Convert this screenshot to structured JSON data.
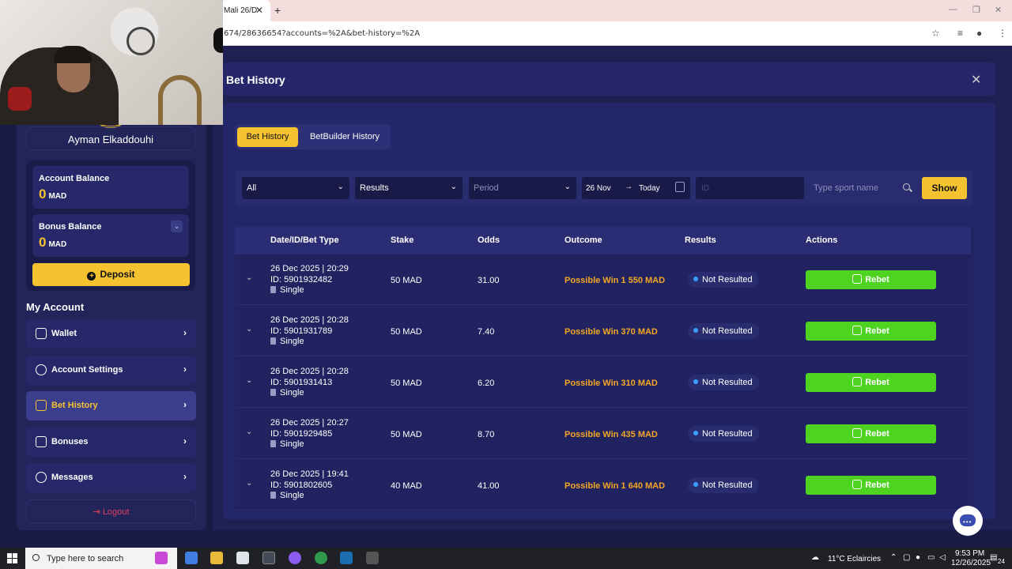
{
  "browser": {
    "tab_title": "Mali 26/D",
    "tab_close": "✕",
    "new_tab": "+",
    "url": "674/28636654?accounts=%2A&bet-history=%2A"
  },
  "sidebar": {
    "username": "Ayman Elkaddouhi",
    "account_balance": {
      "label": "Account Balance",
      "value": "0",
      "unit": "MAD"
    },
    "bonus_balance": {
      "label": "Bonus Balance",
      "value": "0",
      "unit": "MAD"
    },
    "deposit_label": "Deposit",
    "section_title": "My Account",
    "items": [
      {
        "label": "Wallet",
        "active": false
      },
      {
        "label": "Account Settings",
        "active": false
      },
      {
        "label": "Bet History",
        "active": true
      },
      {
        "label": "Bonuses",
        "active": false
      },
      {
        "label": "Messages",
        "active": false
      }
    ],
    "logout_label": "Logout"
  },
  "main": {
    "title": "Bet History",
    "tabs": [
      {
        "label": "Bet History",
        "active": true
      },
      {
        "label": "BetBuilder History",
        "active": false
      }
    ],
    "filters": {
      "type_select": "All",
      "results_select": "Results",
      "period_select": "Period",
      "date_from": "26 Nov",
      "date_to": "Today",
      "id_placeholder": "ID",
      "sport_placeholder": "Type sport name",
      "show_label": "Show"
    },
    "table": {
      "headers": [
        "Date/ID/Bet Type",
        "Stake",
        "Odds",
        "Outcome",
        "Results",
        "Actions"
      ],
      "rows": [
        {
          "date": "26 Dec 2025 | 20:29",
          "id": "ID: 5901932482",
          "type": "Single",
          "stake": "50 MAD",
          "odds": "31.00",
          "outcome": "Possible Win 1 550 MAD",
          "result": "Not Resulted",
          "action": "Rebet"
        },
        {
          "date": "26 Dec 2025 | 20:28",
          "id": "ID: 5901931789",
          "type": "Single",
          "stake": "50 MAD",
          "odds": "7.40",
          "outcome": "Possible Win 370 MAD",
          "result": "Not Resulted",
          "action": "Rebet"
        },
        {
          "date": "26 Dec 2025 | 20:28",
          "id": "ID: 5901931413",
          "type": "Single",
          "stake": "50 MAD",
          "odds": "6.20",
          "outcome": "Possible Win 310 MAD",
          "result": "Not Resulted",
          "action": "Rebet"
        },
        {
          "date": "26 Dec 2025 | 20:27",
          "id": "ID: 5901929485",
          "type": "Single",
          "stake": "50 MAD",
          "odds": "8.70",
          "outcome": "Possible Win 435 MAD",
          "result": "Not Resulted",
          "action": "Rebet"
        },
        {
          "date": "26 Dec 2025 | 19:41",
          "id": "ID: 5901802605",
          "type": "Single",
          "stake": "40 MAD",
          "odds": "41.00",
          "outcome": "Possible Win 1 640 MAD",
          "result": "Not Resulted",
          "action": "Rebet"
        }
      ]
    }
  },
  "taskbar": {
    "search_placeholder": "Type here to search",
    "weather": "11°C  Eclaircies",
    "time": "9:53 PM",
    "date": "12/26/2025",
    "notifications": "24"
  },
  "colors": {
    "accent": "#f5c330",
    "rebet": "#4ed321",
    "outcome": "#f5a623",
    "panel": "#24266a"
  }
}
